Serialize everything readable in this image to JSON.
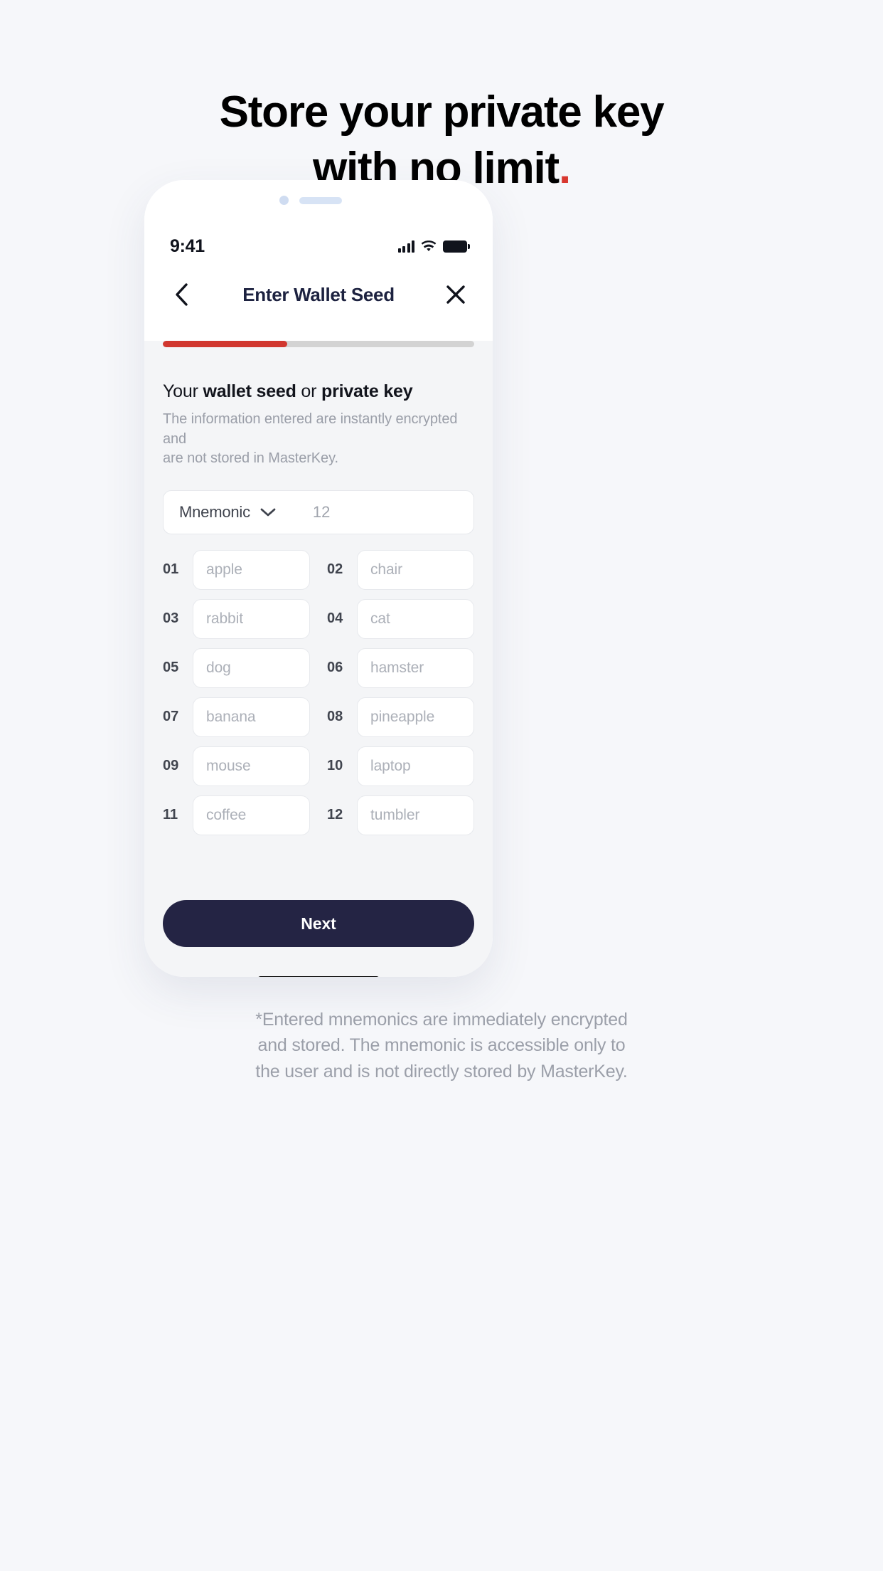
{
  "headline": {
    "line1": "Store your private key",
    "line2": "with no limit",
    "period": ".",
    "accent_color": "#d8372f"
  },
  "phone": {
    "status_bar": {
      "time": "9:41",
      "icons": [
        "cellular-signal-icon",
        "wifi-icon",
        "battery-icon"
      ]
    },
    "nav_bar": {
      "back_label": "‹",
      "title": "Enter Wallet Seed",
      "close_label": "✕"
    },
    "progress": {
      "percent": 40,
      "fill_color": "#d1372f",
      "track_color": "#d3d3d3"
    },
    "section": {
      "title_part1": "Your ",
      "title_part2": "wallet seed",
      "title_part3": " or ",
      "title_part4": "private key",
      "subtitle_line1": "The information entered are instantly encrypted and",
      "subtitle_line2": "are not stored in MasterKey."
    },
    "type_selector": {
      "type_label": "Mnemonic",
      "chevron": "chevron-down-icon",
      "count": "12"
    },
    "seed_words": [
      {
        "index": "01",
        "placeholder": "apple"
      },
      {
        "index": "02",
        "placeholder": "chair"
      },
      {
        "index": "03",
        "placeholder": "rabbit"
      },
      {
        "index": "04",
        "placeholder": "cat"
      },
      {
        "index": "05",
        "placeholder": "dog"
      },
      {
        "index": "06",
        "placeholder": "hamster"
      },
      {
        "index": "07",
        "placeholder": "banana"
      },
      {
        "index": "08",
        "placeholder": "pineapple"
      },
      {
        "index": "09",
        "placeholder": "mouse"
      },
      {
        "index": "10",
        "placeholder": "laptop"
      },
      {
        "index": "11",
        "placeholder": "coffee"
      },
      {
        "index": "12",
        "placeholder": "tumbler"
      }
    ],
    "primary_button": {
      "label": "Next",
      "color": "#242444"
    }
  },
  "footer": {
    "line1": "*Entered mnemonics are immediately encrypted",
    "line2": "and stored. The mnemonic is accessible only to",
    "line3": "the user and is not directly stored by MasterKey."
  }
}
